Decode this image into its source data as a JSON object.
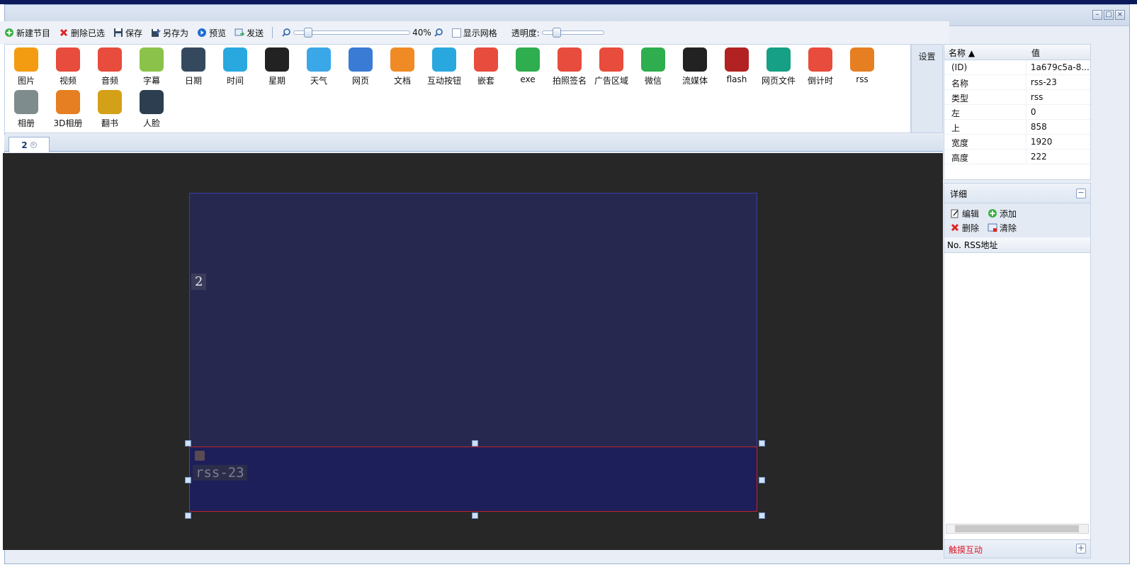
{
  "toolbar": {
    "new_program": "新建节目",
    "delete_selected": "删除已选",
    "save": "保存",
    "save_as": "另存为",
    "preview": "预览",
    "send": "发送",
    "zoom_level": "40%",
    "zoom_fraction": 0.4,
    "show_grid": "显示网格",
    "opacity": "透明度:"
  },
  "palette": {
    "row1": [
      {
        "label": "图片",
        "icon": "image-icon",
        "color": "#f39c12"
      },
      {
        "label": "视频",
        "icon": "video-icon",
        "color": "#e74c3c"
      },
      {
        "label": "音频",
        "icon": "music-icon",
        "color": "#e74c3c"
      },
      {
        "label": "字幕",
        "icon": "marquee-icon",
        "color": "#8bc34a"
      },
      {
        "label": "日期",
        "icon": "calendar-icon",
        "color": "#34495e"
      },
      {
        "label": "时间",
        "icon": "clock-icon",
        "color": "#29a8e0"
      },
      {
        "label": "星期",
        "icon": "week-icon",
        "color": "#222222"
      },
      {
        "label": "天气",
        "icon": "weather-icon",
        "color": "#3aa8e8"
      },
      {
        "label": "网页",
        "icon": "web-icon",
        "color": "#3a7bd5"
      },
      {
        "label": "文档",
        "icon": "document-icon",
        "color": "#f08a24"
      },
      {
        "label": "互动按钮",
        "icon": "touch-icon",
        "color": "#29a8e0"
      },
      {
        "label": "嵌套",
        "icon": "nesting-icon",
        "color": "#e74c3c"
      },
      {
        "label": "exe",
        "icon": "exe-icon",
        "color": "#2eae4e"
      },
      {
        "label": "拍照签名",
        "icon": "camera-icon",
        "color": "#e74c3c"
      },
      {
        "label": "广告区域",
        "icon": "ad-icon",
        "color": "#e74c3c"
      },
      {
        "label": "微信",
        "icon": "wechat-icon",
        "color": "#2eae4e"
      },
      {
        "label": "流媒体",
        "icon": "stream-icon",
        "color": "#222222"
      },
      {
        "label": "flash",
        "icon": "flash-icon",
        "color": "#b22222"
      },
      {
        "label": "网页文件",
        "icon": "html-icon",
        "color": "#16a085"
      },
      {
        "label": "倒计时",
        "icon": "countdown-icon",
        "color": "#e74c3c"
      },
      {
        "label": "rss",
        "icon": "rss-icon",
        "color": "#e67e22"
      }
    ],
    "row2": [
      {
        "label": "相册",
        "icon": "album-icon",
        "color": "#7f8c8d"
      },
      {
        "label": "3D相册",
        "icon": "3d-album-icon",
        "color": "#e67e22"
      },
      {
        "label": "翻书",
        "icon": "book-icon",
        "color": "#d4a017"
      },
      {
        "label": "人脸",
        "icon": "face-icon",
        "color": "#2c3e50"
      }
    ],
    "settings": "设置"
  },
  "tabs": [
    {
      "label": "2"
    }
  ],
  "canvas": {
    "program_label": "2",
    "element_label": "rss-23"
  },
  "properties": {
    "col_name": "名称",
    "col_value": "值",
    "rows": [
      {
        "name": "(ID)",
        "value": "1a679c5a-8..."
      },
      {
        "name": "名称",
        "value": "rss-23"
      },
      {
        "name": "类型",
        "value": "rss"
      },
      {
        "name": "左",
        "value": "0"
      },
      {
        "name": "上",
        "value": "858"
      },
      {
        "name": "宽度",
        "value": "1920"
      },
      {
        "name": "高度",
        "value": "222"
      }
    ]
  },
  "detail": {
    "title": "详细",
    "edit": "编辑",
    "add": "添加",
    "delete": "删除",
    "clear": "清除",
    "col_no": "No.",
    "col_url": "RSS地址",
    "footer": "触摸互动"
  }
}
